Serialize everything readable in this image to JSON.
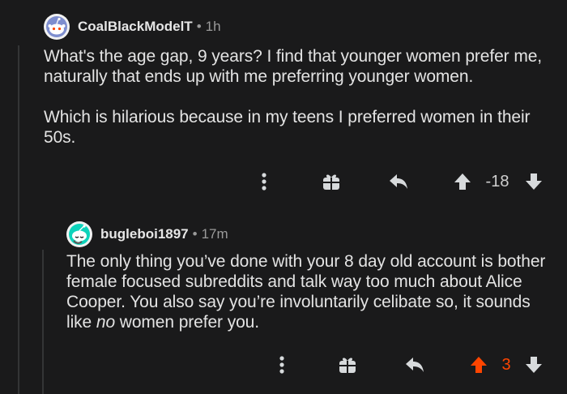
{
  "comments": [
    {
      "username": "CoalBlackModelT",
      "separator": "•",
      "age": "1h",
      "paragraphs": [
        "What's the age gap, 9 years? I find that younger women prefer me, naturally that ends up with me preferring younger women.",
        "Which is hilarious because in my teens I preferred women in their 50s."
      ],
      "score": "-18",
      "vote_state": "none",
      "icons": [
        "more-options-icon",
        "gift-icon",
        "reply-icon",
        "upvote-icon",
        "downvote-icon"
      ]
    },
    {
      "username": "bugleboi1897",
      "separator": "•",
      "age": "17m",
      "paragraph_before_em": "The only thing you’ve done with your 8 day old account is bother female focused subreddits and talk way too much about Alice Cooper. You also say you’re involuntarily celibate so, it sounds like ",
      "paragraph_em": "no",
      "paragraph_after_em": " women prefer you.",
      "score": "3",
      "vote_state": "upvoted",
      "icons": [
        "more-options-icon",
        "gift-icon",
        "reply-icon",
        "upvote-icon",
        "downvote-icon"
      ]
    }
  ],
  "colors": {
    "background": "#1a1a1b",
    "text": "#e3e3e3",
    "muted": "#9a9a9a",
    "upvote_active": "#ff4500",
    "icon": "#d7dadc"
  }
}
